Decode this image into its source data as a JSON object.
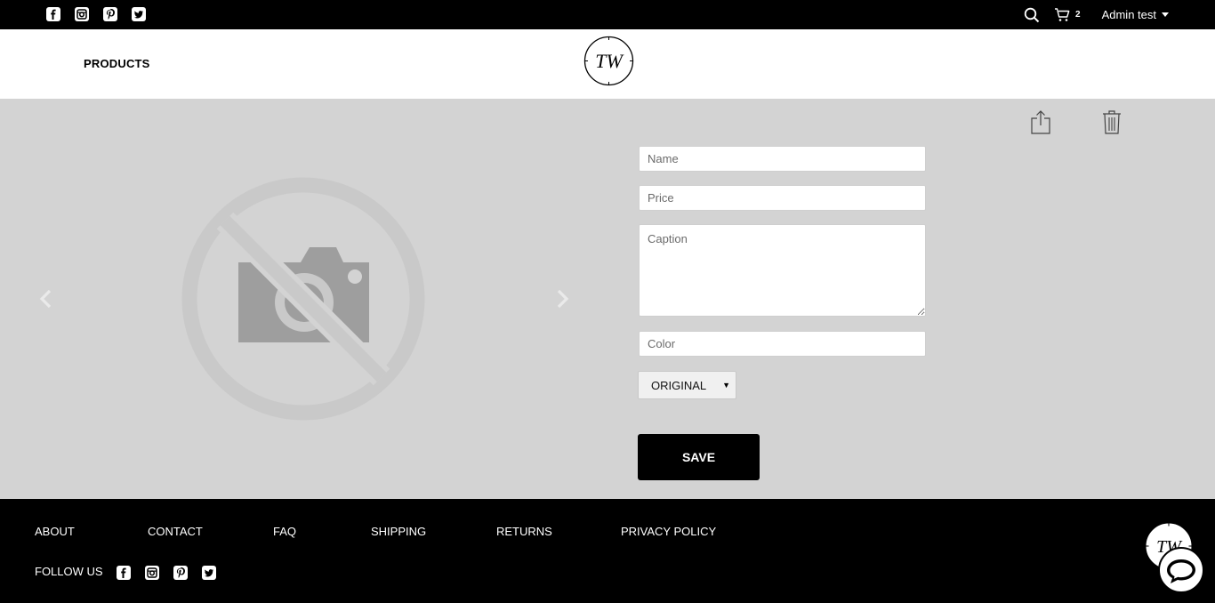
{
  "topbar": {
    "social_icons": [
      "facebook-icon",
      "instagram-icon",
      "pinterest-icon",
      "twitter-icon"
    ],
    "cart_count": "2",
    "user_name": "Admin test"
  },
  "header": {
    "nav_products": "PRODUCTS",
    "logo_text": "TW"
  },
  "form": {
    "name_placeholder": "Name",
    "price_placeholder": "Price",
    "caption_placeholder": "Caption",
    "color_placeholder": "Color",
    "variant_selected": "ORIGINAL",
    "save_label": "SAVE"
  },
  "footer": {
    "links": [
      "ABOUT",
      "CONTACT",
      "FAQ",
      "SHIPPING",
      "RETURNS",
      "PRIVACY POLICY"
    ],
    "follow_label": "FOLLOW US",
    "logo_text": "TW"
  },
  "colors": {
    "bar": "#000000",
    "background": "#d3d3d3",
    "placeholder_icon": "#9e9e9e"
  }
}
